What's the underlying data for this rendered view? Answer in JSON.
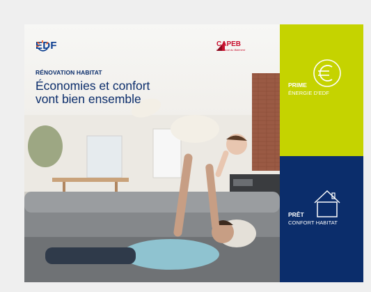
{
  "logos": {
    "edf": "EDF",
    "capeb": "CAPEB",
    "capeb_tagline": "L'Artisanat du Bâtiment"
  },
  "hero": {
    "eyebrow": "RÉNOVATION HABITAT",
    "headline_line1": "Économies et confort",
    "headline_line2": "vont bien ensemble"
  },
  "panels": {
    "prime": {
      "title": "PRIME",
      "subtitle": "ÉNERGIE D'EDF",
      "icon": "euro-icon",
      "color": "#c5d300"
    },
    "pret": {
      "title": "PRÊT",
      "subtitle": "CONFORT HABITAT",
      "icon": "house-icon",
      "color": "#0b2d6b"
    }
  },
  "colors": {
    "edf_blue": "#0a3d8f",
    "edf_orange": "#fe5815",
    "capeb_red": "#c8102e",
    "background": "#efefef"
  }
}
